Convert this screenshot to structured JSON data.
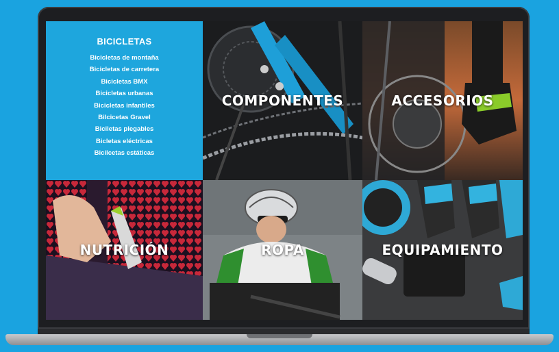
{
  "bicicletas": {
    "title": "BICICLETAS",
    "items": [
      "Bicicletas de montaña",
      "Bicicletas de carretera",
      "Bicicletas BMX",
      "Bicicletas urbanas",
      "Bicicletas infantiles",
      "Bilcicetas Gravel",
      "Biciletas plegables",
      "Bicletas eléctricas",
      "Bicilcetas estáticas"
    ]
  },
  "tiles": {
    "componentes": "COMPONENTES",
    "accesorios": "ACCESORIOS",
    "nutricion": "NUTRICIÓN",
    "ropa": "ROPA",
    "equipamiento": "EQUIPAMIENTO"
  },
  "colors": {
    "background": "#1aa3e0",
    "bicicletas_tile": "#1ea6dd"
  }
}
